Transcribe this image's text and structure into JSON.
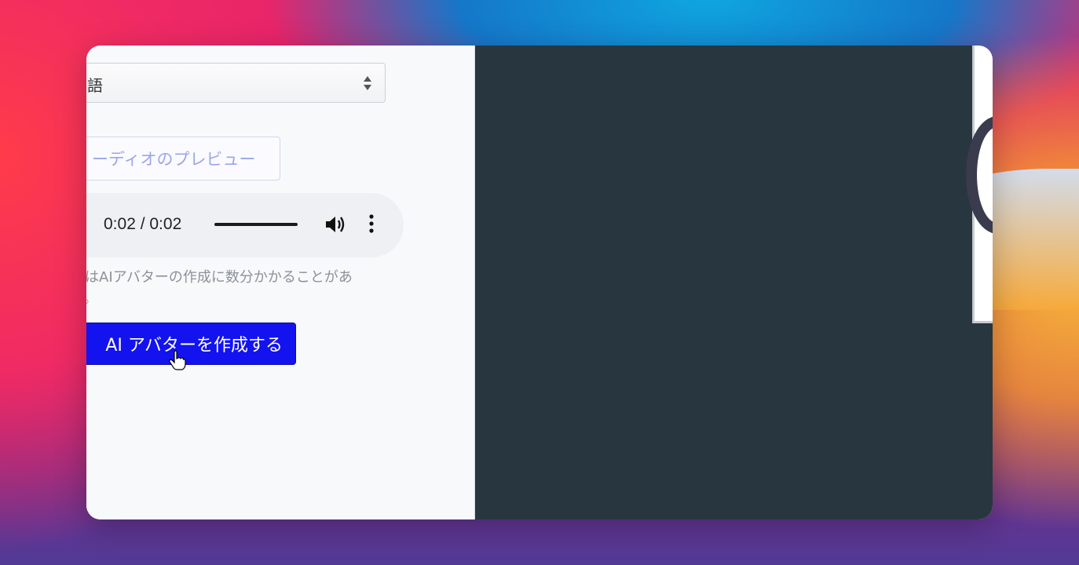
{
  "language_select": {
    "value": "語"
  },
  "audio_preview_button": {
    "label": "ーディオのプレビュー"
  },
  "audio_player": {
    "time": "0:02 / 0:02",
    "progress": 1.0,
    "icons": [
      "volume-icon",
      "more-options-icon"
    ]
  },
  "notice": {
    "line1": "にはAIアバターの作成に数分かかることがあ",
    "line2": "す。"
  },
  "create_button": {
    "label": "AI アバターを作成する",
    "color": "#1313f0"
  },
  "colors": {
    "right_panel": "#283640",
    "left_panel": "#f8f9fa"
  }
}
